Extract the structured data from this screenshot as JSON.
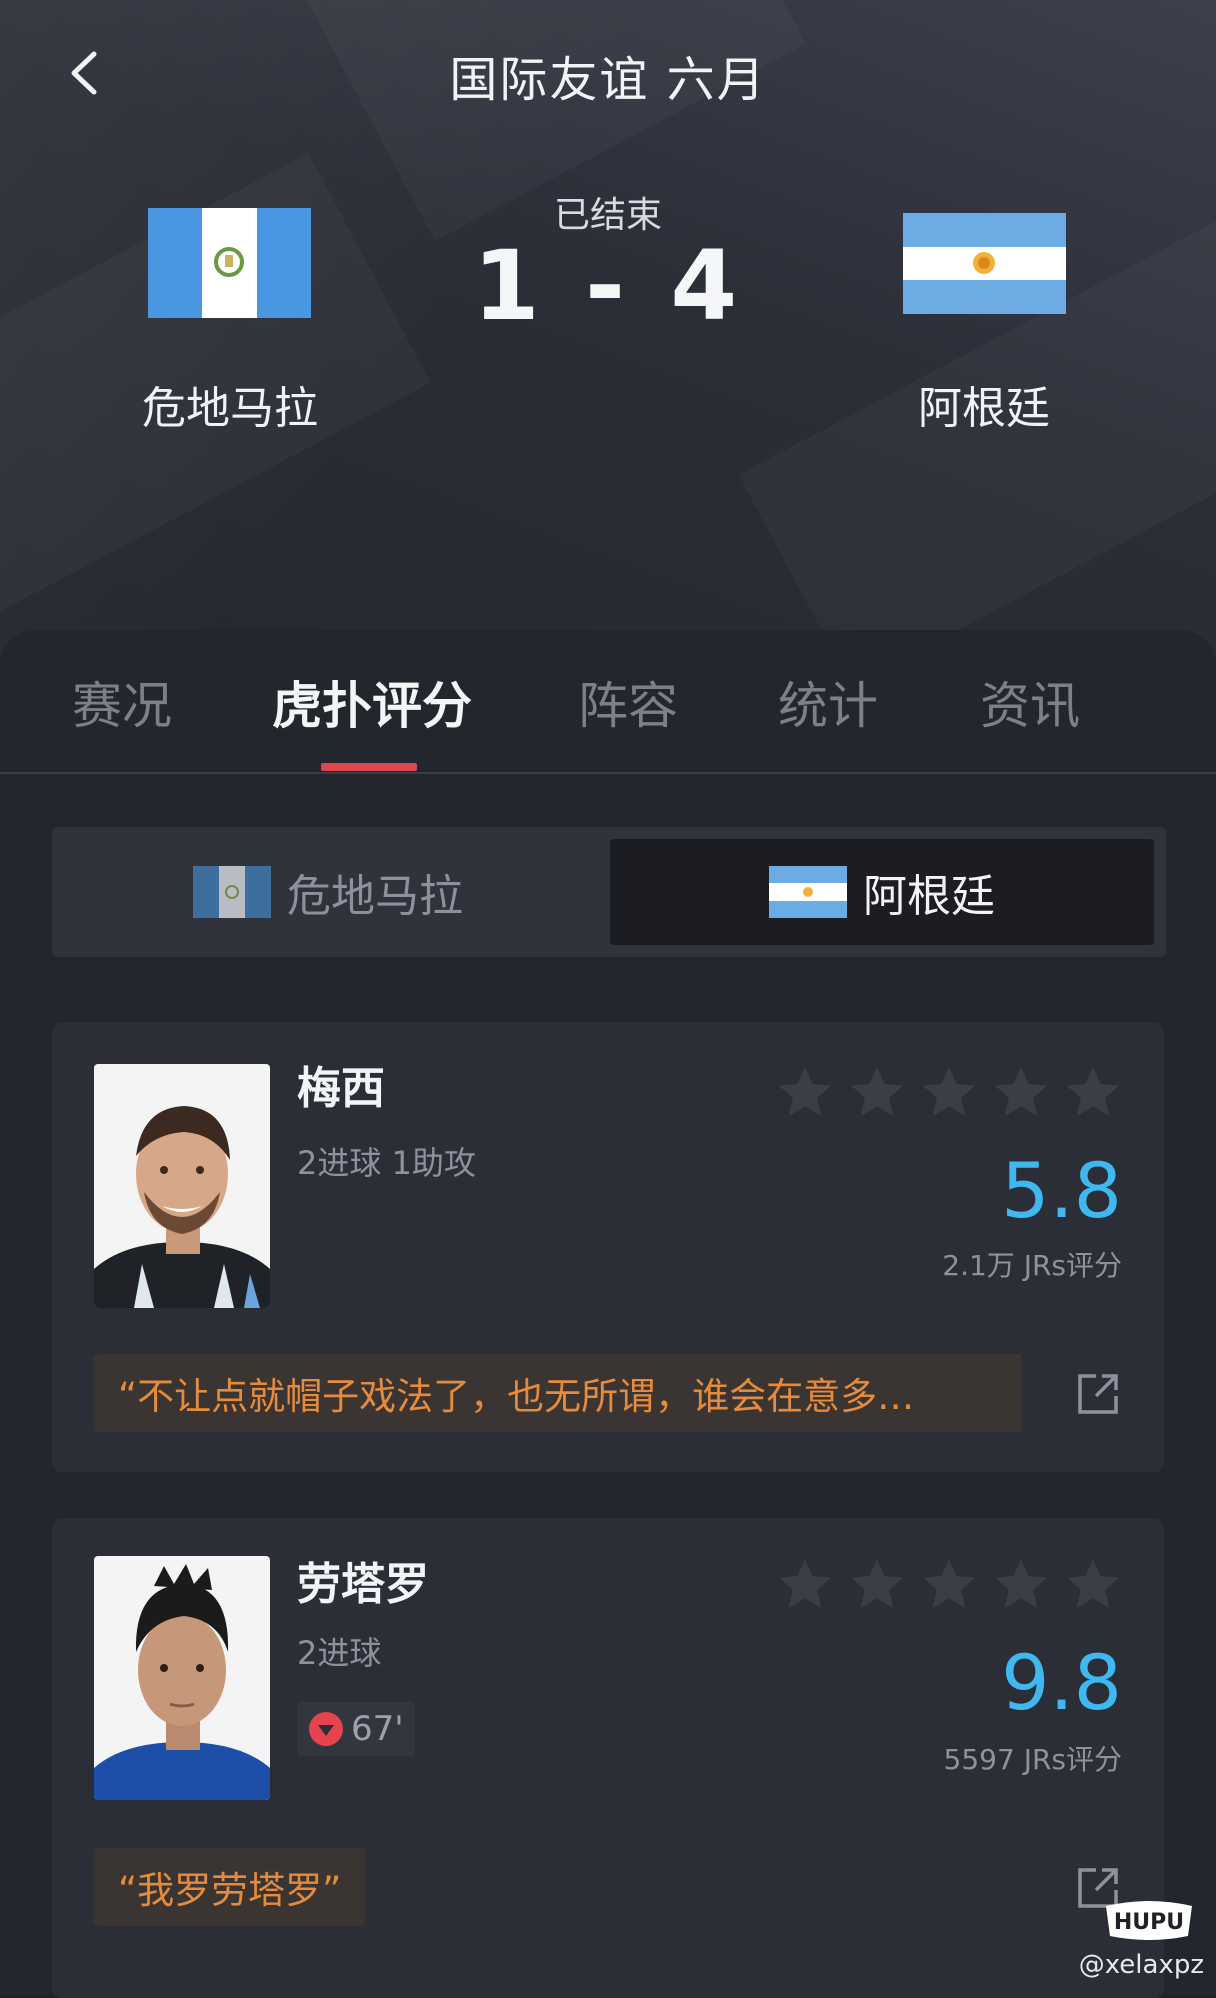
{
  "header": {
    "title": "国际友谊 六月",
    "status": "已结束",
    "score": "1 - 4",
    "home_team": "危地马拉",
    "away_team": "阿根廷"
  },
  "tabs": [
    {
      "label": "赛况",
      "active": false
    },
    {
      "label": "虎扑评分",
      "active": true
    },
    {
      "label": "阵容",
      "active": false
    },
    {
      "label": "统计",
      "active": false
    },
    {
      "label": "资讯",
      "active": false
    }
  ],
  "team_switch": {
    "left": "危地马拉",
    "right": "阿根廷",
    "selected": "阿根廷"
  },
  "players": [
    {
      "name": "梅西",
      "stats": "2进球 1助攻",
      "rating": "5.8",
      "votes": "2.1万 JRs评分",
      "comment": "“不让点就帽子戏法了，也无所谓，谁会在意多…"
    },
    {
      "name": "劳塔罗",
      "stats": "2进球",
      "sub_minute": "67'",
      "rating": "9.8",
      "votes": "5597 JRs评分",
      "comment": "“我罗劳塔罗”"
    }
  ],
  "watermark": {
    "logo": "HUPU",
    "user": "@xelaxpz"
  },
  "colors": {
    "accent_rating": "#3fb8f0",
    "tab_indicator": "#e0464e",
    "comment_text": "#e68a3c"
  }
}
